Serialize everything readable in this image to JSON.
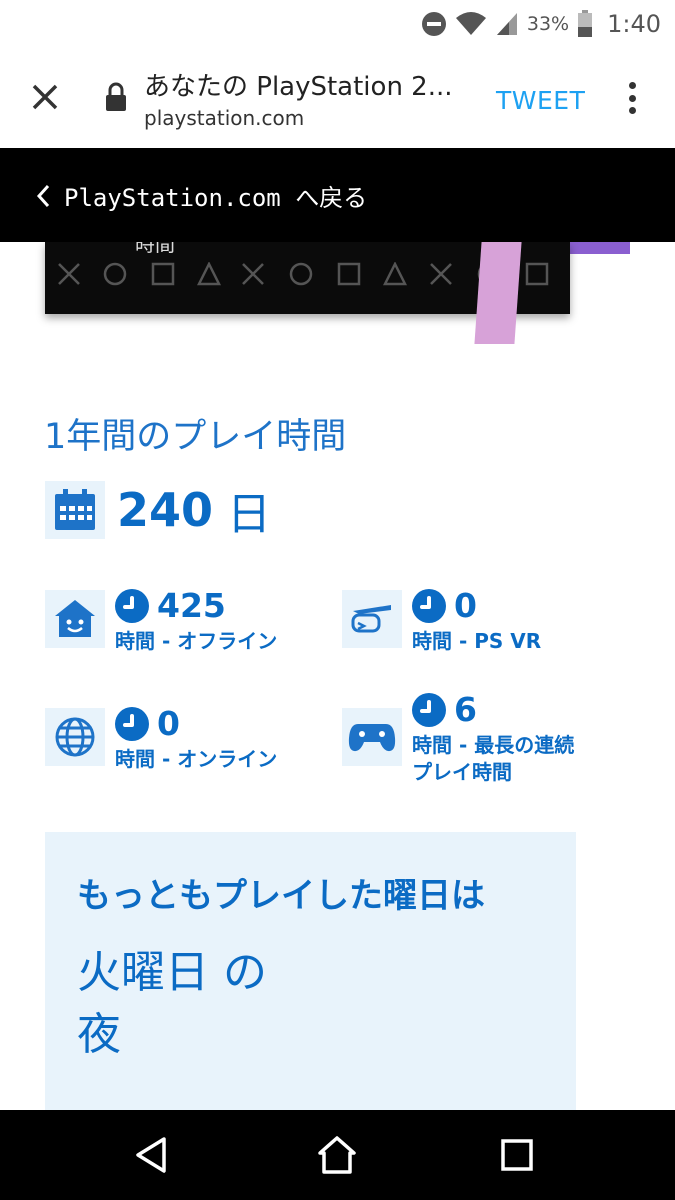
{
  "status_bar": {
    "battery_percent": "33%",
    "time": "1:40",
    "icons": [
      "do-not-disturb-icon",
      "wifi-icon",
      "signal-icon",
      "battery-icon"
    ]
  },
  "browser": {
    "page_title": "あなたの PlayStation 2...",
    "domain": "playstation.com",
    "tweet_label": "TWEET",
    "icons": [
      "close-icon",
      "lock-icon",
      "more-vert-icon"
    ]
  },
  "back_bar": {
    "label": "PlayStation.com へ戻る"
  },
  "card": {
    "peek_text": "時間",
    "shape_symbols": "✕ ○ □ △ ✕ ○ □ △ ✕ ○ □"
  },
  "stats": {
    "section_title": "1年間のプレイ時間",
    "days": {
      "value": "240",
      "unit": "日"
    },
    "items": [
      {
        "icon": "home-face-icon",
        "value": "425",
        "label": "時間 - オフライン"
      },
      {
        "icon": "vr-headset-icon",
        "value": "0",
        "label": "時間 - PS VR"
      },
      {
        "icon": "globe-icon",
        "value": "0",
        "label": "時間 - オンライン"
      },
      {
        "icon": "controller-icon",
        "value": "6",
        "label_line1": "時間 - 最長の連続",
        "label_line2": "プレイ時間"
      }
    ]
  },
  "most_played": {
    "title": "もっともプレイした曜日は",
    "line1": "火曜日 の",
    "line2": "夜"
  },
  "colors": {
    "accent_blue": "#0b6bc4",
    "light_blue_bg": "#e8f3fb",
    "tweet_blue": "#1da1f2",
    "toolbar_line": "#2a6ed8"
  }
}
